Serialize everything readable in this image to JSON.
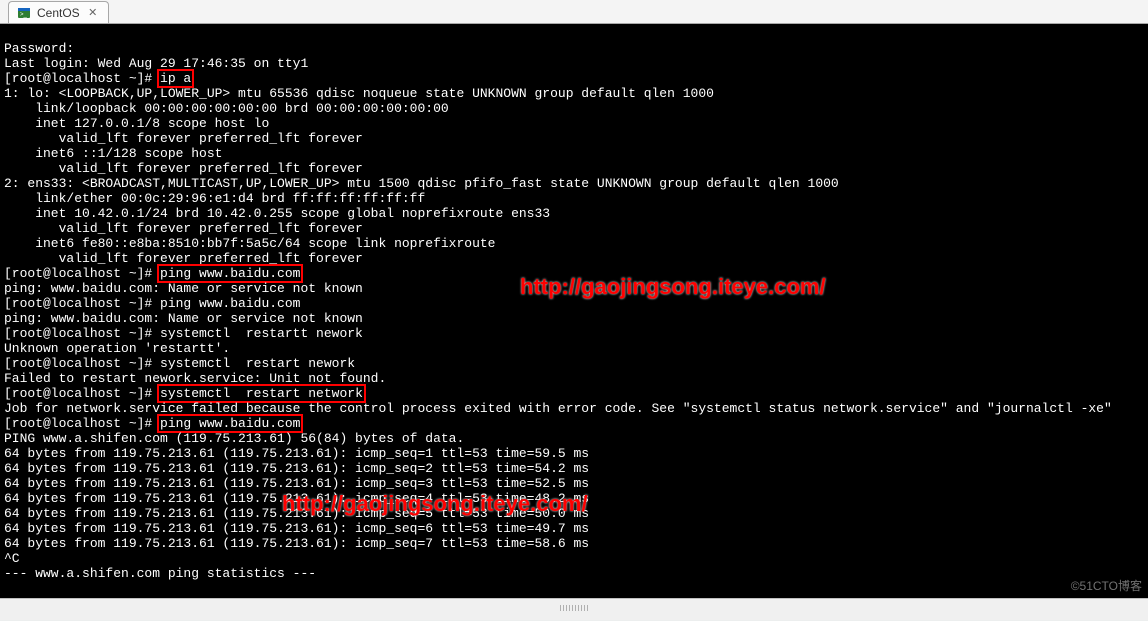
{
  "tab": {
    "label": "CentOS",
    "close": "✕"
  },
  "overlays": {
    "url1": "http://gaojingsong.iteye.com/",
    "url2": "http://gaojingsong.iteye.com/"
  },
  "watermark": "©51CTO博客",
  "commands": {
    "ip_a": "ip a",
    "ping1": "ping www.baidu.com",
    "restart_network": "systemctl  restart network",
    "ping2": "ping www.baidu.com"
  },
  "term": {
    "l0": "Password:",
    "l1": "Last login: Wed Aug 29 17:46:35 on tty1",
    "l2a": "[root@localhost ~]# ",
    "l3": "1: lo: <LOOPBACK,UP,LOWER_UP> mtu 65536 qdisc noqueue state UNKNOWN group default qlen 1000",
    "l4": "    link/loopback 00:00:00:00:00:00 brd 00:00:00:00:00:00",
    "l5": "    inet 127.0.0.1/8 scope host lo",
    "l6": "       valid_lft forever preferred_lft forever",
    "l7": "    inet6 ::1/128 scope host",
    "l8": "       valid_lft forever preferred_lft forever",
    "l9": "2: ens33: <BROADCAST,MULTICAST,UP,LOWER_UP> mtu 1500 qdisc pfifo_fast state UNKNOWN group default qlen 1000",
    "l10": "    link/ether 00:0c:29:96:e1:d4 brd ff:ff:ff:ff:ff:ff",
    "l11": "    inet 10.42.0.1/24 brd 10.42.0.255 scope global noprefixroute ens33",
    "l12": "       valid_lft forever preferred_lft forever",
    "l13": "    inet6 fe80::e8ba:8510:bb7f:5a5c/64 scope link noprefixroute",
    "l14": "       valid_lft forever preferred_lft forever",
    "l15a": "[root@localhost ~]# ",
    "l16": "ping: www.baidu.com: Name or service not known",
    "l17": "[root@localhost ~]# ping www.baidu.com",
    "l18": "ping: www.baidu.com: Name or service not known",
    "l19": "[root@localhost ~]# systemctl  restartt nework",
    "l20": "Unknown operation 'restartt'.",
    "l21": "[root@localhost ~]# systemctl  restart nework",
    "l22": "Failed to restart nework.service: Unit not found.",
    "l23a": "[root@localhost ~]# ",
    "l24": "Job for network.service failed because the control process exited with error code. See \"systemctl status network.service\" and \"journalctl -xe\"",
    "l25a": "[root@localhost ~]# ",
    "l26": "PING www.a.shifen.com (119.75.213.61) 56(84) bytes of data.",
    "l27": "64 bytes from 119.75.213.61 (119.75.213.61): icmp_seq=1 ttl=53 time=59.5 ms",
    "l28": "64 bytes from 119.75.213.61 (119.75.213.61): icmp_seq=2 ttl=53 time=54.2 ms",
    "l29": "64 bytes from 119.75.213.61 (119.75.213.61): icmp_seq=3 ttl=53 time=52.5 ms",
    "l30": "64 bytes from 119.75.213.61 (119.75.213.61): icmp_seq=4 ttl=53 time=48.2 ms",
    "l31": "64 bytes from 119.75.213.61 (119.75.213.61): icmp_seq=5 ttl=53 time=50.0 ms",
    "l32": "64 bytes from 119.75.213.61 (119.75.213.61): icmp_seq=6 ttl=53 time=49.7 ms",
    "l33": "64 bytes from 119.75.213.61 (119.75.213.61): icmp_seq=7 ttl=53 time=58.6 ms",
    "l34": "^C",
    "l35": "--- www.a.shifen.com ping statistics ---"
  }
}
